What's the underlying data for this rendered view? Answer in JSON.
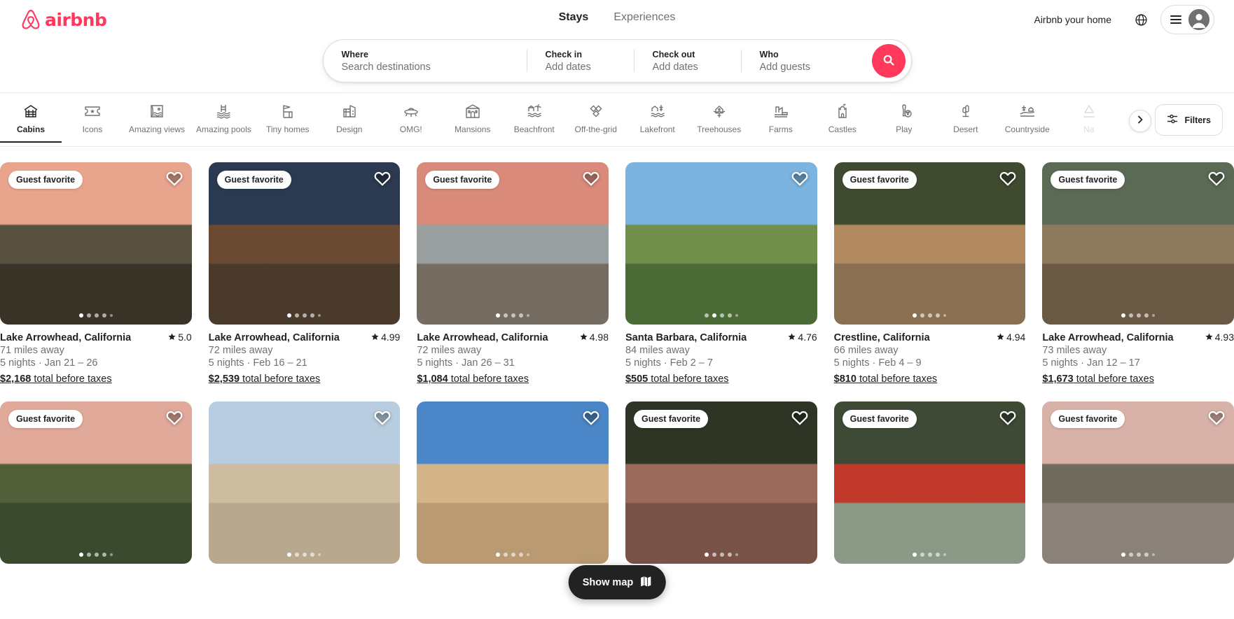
{
  "header": {
    "brand": "airbnb",
    "tabs": [
      {
        "label": "Stays",
        "active": true
      },
      {
        "label": "Experiences",
        "active": false
      }
    ],
    "host_link": "Airbnb your home",
    "globe_icon": "globe-icon",
    "menu_icon": "hamburger-icon",
    "avatar_icon": "user-avatar-icon"
  },
  "search": {
    "where_label": "Where",
    "where_placeholder": "Search destinations",
    "checkin_label": "Check in",
    "checkin_value": "Add dates",
    "checkout_label": "Check out",
    "checkout_value": "Add dates",
    "who_label": "Who",
    "who_value": "Add guests",
    "search_icon": "search-icon",
    "search_button_color": "#FF385C"
  },
  "categories": {
    "items": [
      {
        "label": "Cabins",
        "icon": "cabin-icon",
        "active": true
      },
      {
        "label": "Icons",
        "icon": "ticket-star-icon",
        "active": false
      },
      {
        "label": "Amazing views",
        "icon": "amazing-views-icon",
        "active": false
      },
      {
        "label": "Amazing pools",
        "icon": "amazing-pools-icon",
        "active": false
      },
      {
        "label": "Tiny homes",
        "icon": "tiny-home-icon",
        "active": false
      },
      {
        "label": "Design",
        "icon": "design-icon",
        "active": false
      },
      {
        "label": "OMG!",
        "icon": "omg-ufo-icon",
        "active": false
      },
      {
        "label": "Mansions",
        "icon": "mansion-icon",
        "active": false
      },
      {
        "label": "Beachfront",
        "icon": "beachfront-icon",
        "active": false
      },
      {
        "label": "Off-the-grid",
        "icon": "off-the-grid-icon",
        "active": false
      },
      {
        "label": "Lakefront",
        "icon": "lakefront-icon",
        "active": false
      },
      {
        "label": "Treehouses",
        "icon": "treehouse-icon",
        "active": false
      },
      {
        "label": "Farms",
        "icon": "farm-icon",
        "active": false
      },
      {
        "label": "Castles",
        "icon": "castle-icon",
        "active": false
      },
      {
        "label": "Play",
        "icon": "play-bowling-icon",
        "active": false
      },
      {
        "label": "Desert",
        "icon": "desert-cactus-icon",
        "active": false
      },
      {
        "label": "Countryside",
        "icon": "countryside-icon",
        "active": false
      },
      {
        "label": "Na",
        "icon": "national-parks-icon",
        "active": false,
        "clipped": true
      }
    ],
    "next_icon": "chevron-right-icon",
    "filters_label": "Filters",
    "filters_icon": "filter-sliders-icon"
  },
  "listings": [
    {
      "badge": "Guest favorite",
      "title": "Lake Arrowhead, California",
      "rating": "5.0",
      "distance": "71 miles away",
      "dates": "5 nights · Jan 21 – 26",
      "price": "$2,168",
      "price_tail": " total before taxes",
      "dots": 5,
      "dot_active": 0,
      "sky": "#e8a48c",
      "ground": "#3a3328",
      "mid": "#5a5240"
    },
    {
      "badge": "Guest favorite",
      "title": "Lake Arrowhead, California",
      "rating": "4.99",
      "distance": "72 miles away",
      "dates": "5 nights · Feb 16 – 21",
      "price": "$2,539",
      "price_tail": " total before taxes",
      "dots": 5,
      "dot_active": 0,
      "sky": "#2b3a50",
      "ground": "#4a3a2c",
      "mid": "#6b4a33"
    },
    {
      "badge": "Guest favorite",
      "title": "Lake Arrowhead, California",
      "rating": "4.98",
      "distance": "72 miles away",
      "dates": "5 nights · Jan 26 – 31",
      "price": "$1,084",
      "price_tail": " total before taxes",
      "dots": 5,
      "dot_active": 0,
      "sky": "#d98a7a",
      "ground": "#756d62",
      "mid": "#9aa0a0"
    },
    {
      "badge": "",
      "title": "Santa Barbara, California",
      "rating": "4.76",
      "distance": "84 miles away",
      "dates": "5 nights · Feb 2 – 7",
      "price": "$505",
      "price_tail": " total before taxes",
      "dots": 5,
      "dot_active": 1,
      "sky": "#7bb4e0",
      "ground": "#4a6b35",
      "mid": "#6f8f4a"
    },
    {
      "badge": "Guest favorite",
      "title": "Crestline, California",
      "rating": "4.94",
      "distance": "66 miles away",
      "dates": "5 nights · Feb 4 – 9",
      "price": "$810",
      "price_tail": " total before taxes",
      "dots": 5,
      "dot_active": 0,
      "sky": "#3f4a30",
      "ground": "#8a6f50",
      "mid": "#b08a5e"
    },
    {
      "badge": "Guest favorite",
      "title": "Lake Arrowhead, California",
      "rating": "4.93",
      "distance": "73 miles away",
      "dates": "5 nights · Jan 12 – 17",
      "price": "$1,673",
      "price_tail": " total before taxes",
      "dots": 5,
      "dot_active": 0,
      "sky": "#5a6a55",
      "ground": "#6a5a45",
      "mid": "#8d7a5c"
    },
    {
      "badge": "Guest favorite",
      "title": "",
      "rating": "",
      "distance": "",
      "dates": "",
      "price": "",
      "price_tail": "",
      "dots": 5,
      "dot_active": 0,
      "sky": "#e0a99a",
      "ground": "#3a4a2e",
      "mid": "#52603a"
    },
    {
      "badge": "",
      "title": "",
      "rating": "",
      "distance": "",
      "dates": "",
      "price": "",
      "price_tail": "",
      "dots": 5,
      "dot_active": 0,
      "sky": "#b8cde0",
      "ground": "#b8a88e",
      "mid": "#cdbda0"
    },
    {
      "badge": "",
      "title": "",
      "rating": "",
      "distance": "",
      "dates": "",
      "price": "",
      "price_tail": "",
      "dots": 5,
      "dot_active": 0,
      "sky": "#4a86c8",
      "ground": "#b99a72",
      "mid": "#d4b489"
    },
    {
      "badge": "Guest favorite",
      "title": "",
      "rating": "",
      "distance": "",
      "dates": "",
      "price": "",
      "price_tail": "",
      "dots": 5,
      "dot_active": 0,
      "sky": "#2e3525",
      "ground": "#7a5348",
      "mid": "#9c6a5a"
    },
    {
      "badge": "Guest favorite",
      "title": "",
      "rating": "",
      "distance": "",
      "dates": "",
      "price": "",
      "price_tail": "",
      "dots": 5,
      "dot_active": 0,
      "sky": "#3e4a35",
      "ground": "#8a9a86",
      "mid": "#c0392b"
    },
    {
      "badge": "Guest favorite",
      "title": "",
      "rating": "",
      "distance": "",
      "dates": "",
      "price": "",
      "price_tail": "",
      "dots": 5,
      "dot_active": 0,
      "sky": "#d8b2a8",
      "ground": "#8a8278",
      "mid": "#6e6a5e"
    }
  ],
  "map_button": {
    "label": "Show map",
    "icon": "map-icon"
  }
}
